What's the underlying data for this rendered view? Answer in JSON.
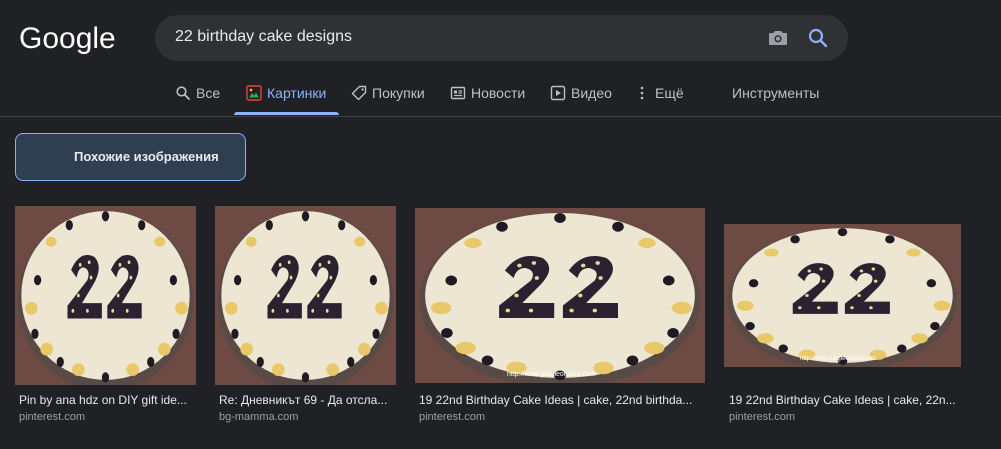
{
  "logo": {
    "text": "Google"
  },
  "search": {
    "query": "22 birthday cake designs"
  },
  "tabs": [
    {
      "label": "Все",
      "icon": "search-icon"
    },
    {
      "label": "Картинки",
      "icon": "images-icon",
      "active": true
    },
    {
      "label": "Покупки",
      "icon": "tag-icon"
    },
    {
      "label": "Новости",
      "icon": "news-icon"
    },
    {
      "label": "Видео",
      "icon": "video-icon"
    },
    {
      "label": "Ещё",
      "icon": "more-vert-icon"
    }
  ],
  "tools_label": "Инструменты",
  "related": {
    "label": "Похожие изображения"
  },
  "results": [
    {
      "title": "Pin by ana hdz on DIY gift ide...",
      "source": "pinterest.com"
    },
    {
      "title": "Re: Дневникът 69 - Да отсла...",
      "source": "bg-mamma.com"
    },
    {
      "title": "19 22nd Birthday Cake Ideas | cake, 22nd birthda...",
      "source": "pinterest.com",
      "watermark": "http://www.jungleofcake.com"
    },
    {
      "title": "19 22nd Birthday Cake Ideas | cake, 22n...",
      "source": "pinterest.com",
      "watermark": "http://www.jungleofcake.com"
    }
  ],
  "colors": {
    "background": "#202124",
    "search_bg": "#303134",
    "accent": "#8ab4f8",
    "text": "#e8eaed",
    "muted": "#9aa0a6"
  }
}
